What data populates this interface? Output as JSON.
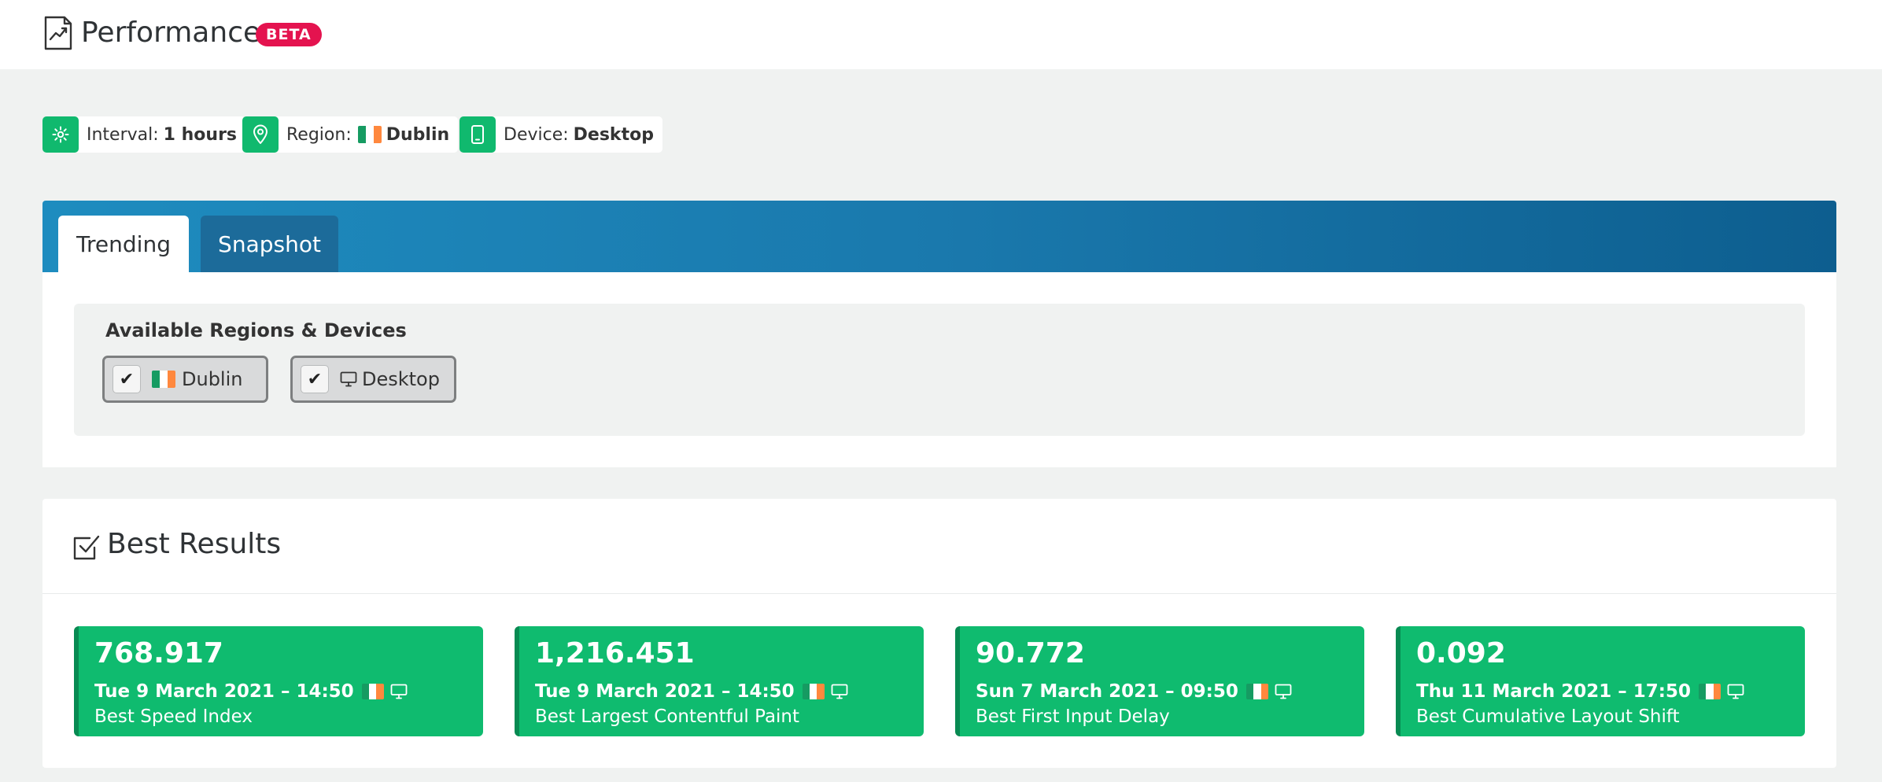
{
  "header": {
    "title": "Performance",
    "badge": "BETA"
  },
  "pills": {
    "interval": {
      "label": "Interval:",
      "value": "1 hours"
    },
    "region": {
      "label": "Region:",
      "value": "Dublin"
    },
    "device": {
      "label": "Device:",
      "value": "Desktop"
    }
  },
  "tabs": [
    {
      "label": "Trending"
    },
    {
      "label": "Snapshot"
    }
  ],
  "regions": {
    "heading": "Available Regions & Devices",
    "toggles": [
      {
        "label": "Dublin"
      },
      {
        "label": "Desktop"
      }
    ]
  },
  "best": {
    "title": "Best Results",
    "cards": [
      {
        "value": "768.917",
        "date": "Tue 9 March 2021 – 14:50",
        "metric": "Best Speed Index"
      },
      {
        "value": "1,216.451",
        "date": "Tue 9 March 2021 – 14:50",
        "metric": "Best Largest Contentful Paint"
      },
      {
        "value": "90.772",
        "date": "Sun 7 March 2021 – 09:50",
        "metric": "Best First Input Delay"
      },
      {
        "value": "0.092",
        "date": "Thu 11 March 2021 – 17:50",
        "metric": "Best Cumulative Layout Shift"
      }
    ]
  },
  "colors": {
    "accent": "#10b96e",
    "badge": "#e4134f",
    "tabbar": "#1a79ad"
  }
}
